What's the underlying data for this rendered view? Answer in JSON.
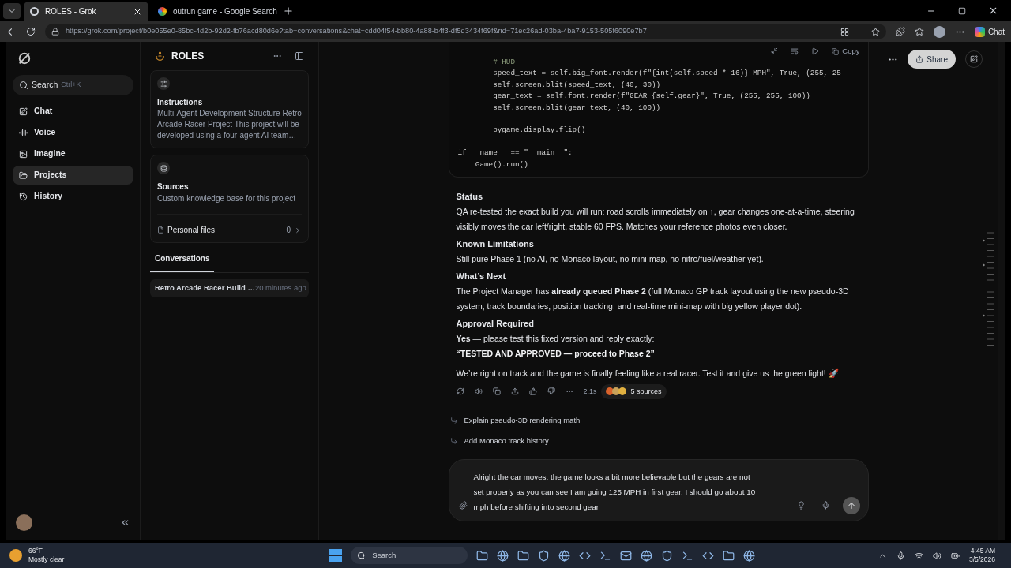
{
  "browser": {
    "tabs": [
      {
        "title": "ROLES - Grok",
        "selected": true
      },
      {
        "title": "outrun game - Google Search",
        "selected": false
      }
    ],
    "url": "https://grok.com/project/b0e055e0-85bc-4d2b-92d2-fb76acd80d6e?tab=conversations&chat=cdd04f54-bb80-4a88-b4f3-df5d3434f69f&rid=71ec26ad-03ba-4ba7-9153-505f6090e7b7",
    "copilot_label": "Chat"
  },
  "sidebar": {
    "search": {
      "label": "Search",
      "shortcut": "Ctrl+K"
    },
    "items": [
      {
        "label": "Chat",
        "selected": false
      },
      {
        "label": "Voice",
        "selected": false
      },
      {
        "label": "Imagine",
        "selected": false
      },
      {
        "label": "Projects",
        "selected": true
      },
      {
        "label": "History",
        "selected": false
      }
    ]
  },
  "project": {
    "title": "ROLES",
    "instructions": {
      "title": "Instructions",
      "text": "Multi-Agent Development Structure Retro Arcade Racer Project This project will be developed using a four-agent AI team…"
    },
    "sources": {
      "title": "Sources",
      "text": "Custom knowledge base for this project",
      "files_label": "Personal files",
      "files_count": "0"
    },
    "tabs": [
      {
        "label": "Conversations",
        "selected": true
      }
    ],
    "conversations": [
      {
        "title": "Retro Arcade Racer Build …",
        "time": "20 minutes ago"
      }
    ]
  },
  "code": {
    "copy_label": "Copy",
    "lines": [
      {
        "kind": "comment",
        "text": "        # HUD"
      },
      {
        "kind": "code",
        "text": "        speed_text = self.big_font.render(f\"{int(self.speed * 16)} MPH\", True, (255, 25"
      },
      {
        "kind": "code",
        "text": "        self.screen.blit(speed_text, (40, 30))"
      },
      {
        "kind": "code",
        "text": "        gear_text = self.font.render(f\"GEAR {self.gear}\", True, (255, 255, 100))"
      },
      {
        "kind": "code",
        "text": "        self.screen.blit(gear_text, (40, 100))"
      },
      {
        "kind": "blank"
      },
      {
        "kind": "code",
        "text": "        pygame.display.flip()"
      },
      {
        "kind": "blank"
      },
      {
        "kind": "code",
        "text": "if __name__ == \"__main__\":"
      },
      {
        "kind": "code",
        "text": "    Game().run()"
      }
    ]
  },
  "response": [
    {
      "kind": "heading",
      "text": "Status"
    },
    {
      "kind": "paragraph",
      "text": "QA re-tested the exact build you will run: road scrolls immediately on ↑, gear changes one-at-a-time, steering visibly moves the car left/right, stable 60 FPS. Matches your reference photos even closer."
    },
    {
      "kind": "heading",
      "text": "Known Limitations"
    },
    {
      "kind": "paragraph",
      "text": "Still pure Phase 1 (no AI, no Monaco layout, no mini-map, no nitro/fuel/weather yet)."
    },
    {
      "kind": "heading",
      "text": "What’s Next"
    },
    {
      "kind": "paragraph",
      "text": "The Project Manager has **already queued Phase 2** (full Monaco GP track layout using the new pseudo-3D system, track boundaries, position tracking, and real-time mini-map with big yellow player dot)."
    },
    {
      "kind": "heading",
      "text": "Approval Required"
    },
    {
      "kind": "paragraph",
      "text": "**Yes** — please test this fixed version and reply exactly:"
    },
    {
      "kind": "quote",
      "text": "“TESTED AND APPROVED — proceed to Phase 2”"
    },
    {
      "kind": "closing",
      "text": "We’re right on track and the game is finally feeling like a real racer. Test it and give us the green light! 🚀"
    }
  ],
  "response_meta": {
    "time": "2.1s",
    "sources": "5 sources",
    "source_icons": [
      {
        "color": "#d9622b"
      },
      {
        "color": "#c9a25a"
      },
      {
        "color": "#e0b040"
      }
    ]
  },
  "suggestions": [
    "Explain pseudo-3D rendering math",
    "Add Monaco track history"
  ],
  "header": {
    "share": "Share"
  },
  "composer": {
    "value": "Alright the car moves, the game looks a bit more believable but the gears are not set properly as you can see I am going 125 MPH in first gear. I should go about 10 mph before shifting into second gear"
  },
  "taskbar": {
    "temperature": "66°F",
    "weather": "Mostly clear",
    "search": "Search",
    "time": "4:45 AM",
    "date": "3/5/2026"
  }
}
